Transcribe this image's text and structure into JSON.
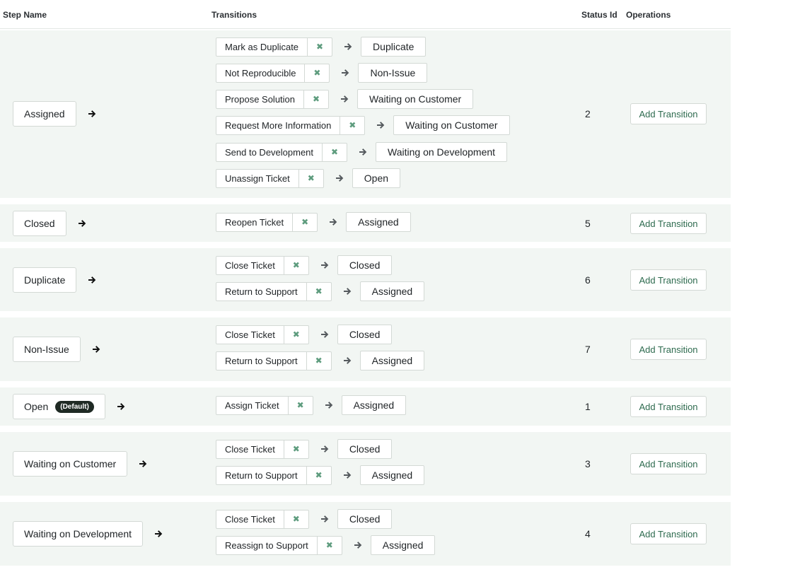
{
  "header": {
    "step_name": "Step Name",
    "transitions": "Transitions",
    "status_id": "Status Id",
    "operations": "Operations"
  },
  "icons": {
    "arrow": "arrow-right-icon",
    "remove": "close-icon",
    "remove_color": "#5e9c7e",
    "row_bg": "#f2f6f3",
    "link_color": "#2e6b4f"
  },
  "steps": [
    {
      "name": "Assigned",
      "default_badge": "",
      "status_id": "2",
      "op_label": "Add Transition",
      "transitions": [
        {
          "label": "Mark as Duplicate",
          "target": "Duplicate"
        },
        {
          "label": "Not Reproducible",
          "target": "Non-Issue"
        },
        {
          "label": "Propose Solution",
          "target": "Waiting on Customer"
        },
        {
          "label": "Request More Information",
          "target": "Waiting on Customer"
        },
        {
          "label": "Send to Development",
          "target": "Waiting on Development"
        },
        {
          "label": "Unassign Ticket",
          "target": "Open"
        }
      ]
    },
    {
      "name": "Closed",
      "default_badge": "",
      "status_id": "5",
      "op_label": "Add Transition",
      "transitions": [
        {
          "label": "Reopen Ticket",
          "target": "Assigned"
        }
      ]
    },
    {
      "name": "Duplicate",
      "default_badge": "",
      "status_id": "6",
      "op_label": "Add Transition",
      "transitions": [
        {
          "label": "Close Ticket",
          "target": "Closed"
        },
        {
          "label": "Return to Support",
          "target": "Assigned"
        }
      ]
    },
    {
      "name": "Non-Issue",
      "default_badge": "",
      "status_id": "7",
      "op_label": "Add Transition",
      "transitions": [
        {
          "label": "Close Ticket",
          "target": "Closed"
        },
        {
          "label": "Return to Support",
          "target": "Assigned"
        }
      ]
    },
    {
      "name": "Open",
      "default_badge": "(Default)",
      "status_id": "1",
      "op_label": "Add Transition",
      "transitions": [
        {
          "label": "Assign Ticket",
          "target": "Assigned"
        }
      ]
    },
    {
      "name": "Waiting on Customer",
      "default_badge": "",
      "status_id": "3",
      "op_label": "Add Transition",
      "transitions": [
        {
          "label": "Close Ticket",
          "target": "Closed"
        },
        {
          "label": "Return to Support",
          "target": "Assigned"
        }
      ]
    },
    {
      "name": "Waiting on Development",
      "default_badge": "",
      "status_id": "4",
      "op_label": "Add Transition",
      "transitions": [
        {
          "label": "Close Ticket",
          "target": "Closed"
        },
        {
          "label": "Reassign to Support",
          "target": "Assigned"
        }
      ]
    }
  ]
}
